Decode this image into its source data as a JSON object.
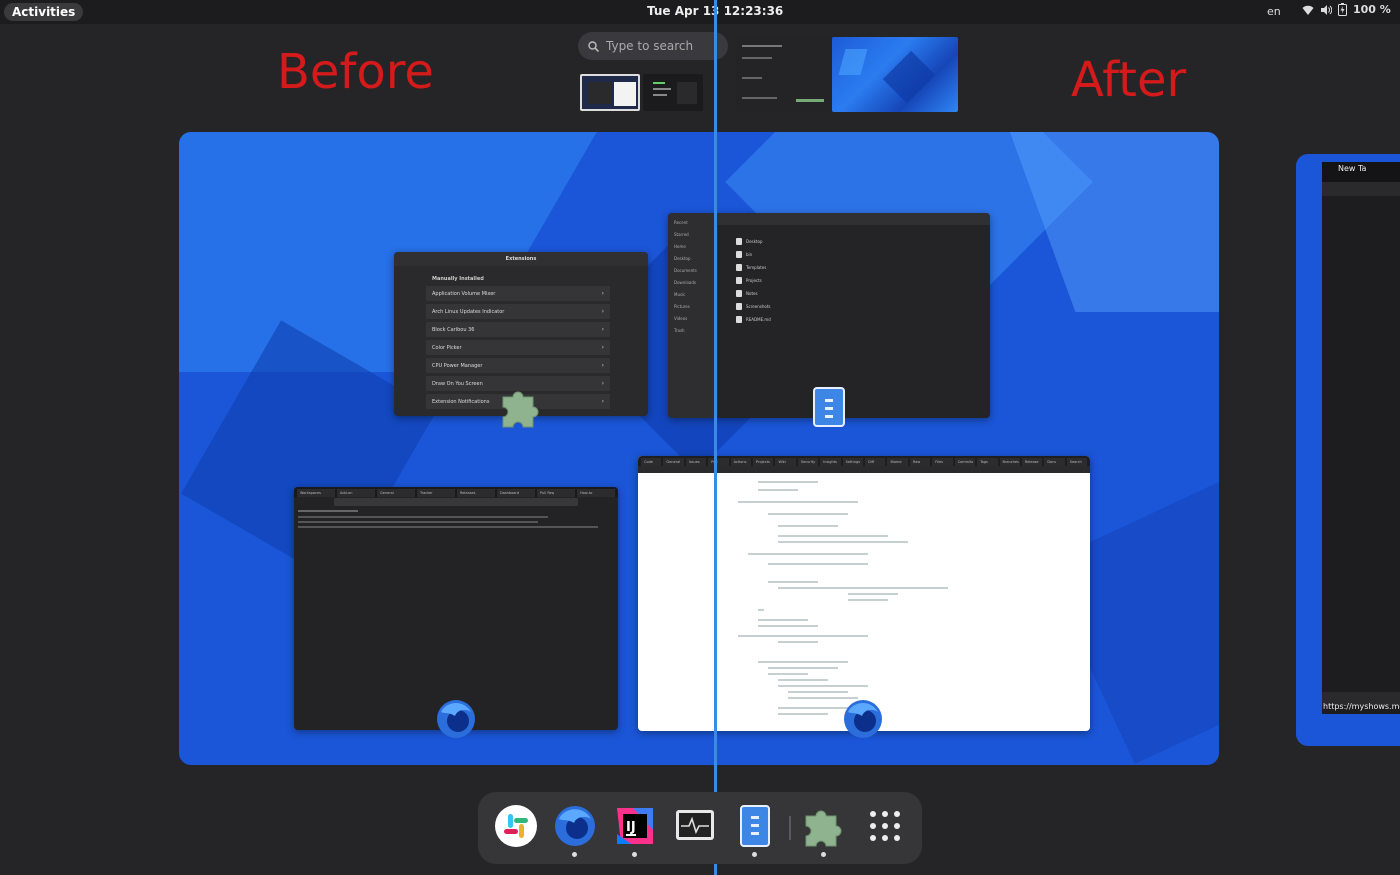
{
  "topbar": {
    "activities": "Activities",
    "clock": "Tue Apr 13  12:23:36",
    "language": "en",
    "battery": "100 %"
  },
  "annotations": {
    "before": "Before",
    "after": "After"
  },
  "search": {
    "placeholder": "Type to search"
  },
  "windows": {
    "extensions": {
      "title": "Extensions",
      "section": "Manually Installed",
      "rows": [
        "Application Volume Mixer",
        "Arch Linux Updates Indicator",
        "Block Caribou 36",
        "Color Picker",
        "CPU Power Manager",
        "Draw On You Screen",
        "Extension Notifications"
      ]
    },
    "files": {
      "sidebar": [
        "Recent",
        "Starred",
        "Home",
        "Desktop",
        "Documents",
        "Downloads",
        "Music",
        "Pictures",
        "Videos",
        "Trash"
      ],
      "items": [
        "Desktop",
        "bin",
        "Templates",
        "Projects",
        "Notes",
        "Screenshots",
        "README.md"
      ]
    },
    "browser_before": {
      "tabs": [
        "Workspaces",
        "Add-on",
        "General",
        "Tracker",
        "Releases",
        "Dashboard",
        "Pull Req",
        "How-to"
      ]
    },
    "browser_after": {
      "tabs": [
        "Code",
        "General",
        "Issues",
        "Pull",
        "Actions",
        "Projects",
        "Wiki",
        "Security",
        "Insights",
        "Settings",
        "Diff",
        "Blame",
        "Raw",
        "Files",
        "Commits",
        "Tags",
        "Branches",
        "Release",
        "Docs",
        "Search"
      ]
    },
    "partial": {
      "tab": "New Ta",
      "url": "https://myshows.me"
    }
  },
  "dash": {
    "apps": [
      {
        "name": "slack",
        "running": false
      },
      {
        "name": "firefox",
        "running": true
      },
      {
        "name": "intellij",
        "running": true
      },
      {
        "name": "system-monitor",
        "running": false
      },
      {
        "name": "files",
        "running": true
      },
      {
        "name": "extensions",
        "running": true
      },
      {
        "name": "show-apps",
        "running": false
      }
    ]
  },
  "colors": {
    "annotation": "#d41a1a",
    "divider": "#3b8be6",
    "wallpaper": "#1b56d8"
  }
}
